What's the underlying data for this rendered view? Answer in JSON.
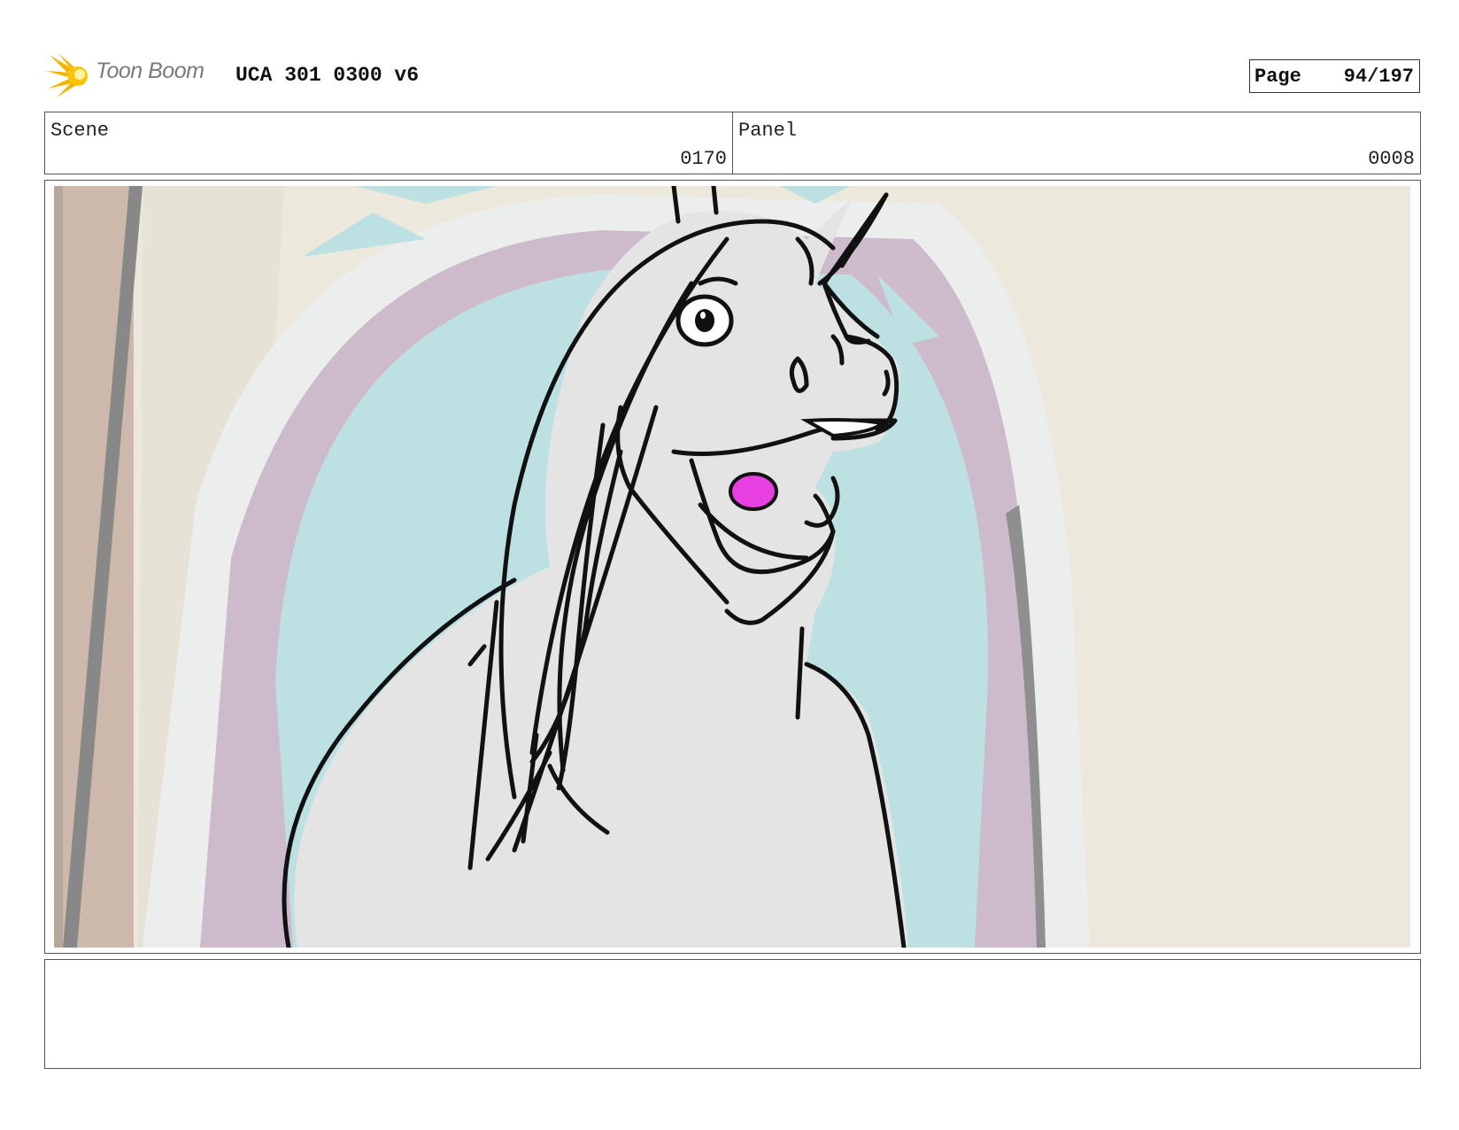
{
  "header": {
    "logo_text": "Toon Boom",
    "project_title": "UCA 301 0300 v6",
    "page_label": "Page",
    "page_value": "94/197"
  },
  "scene": {
    "label": "Scene",
    "value": "0170"
  },
  "panel": {
    "label": "Panel",
    "value": "0008"
  },
  "artwork": {
    "subject": "storyboard-sketch-unicorn",
    "colors": {
      "wall": "#ede8dc",
      "sky": "#bde0e3",
      "arch_trim": "#cfbccb",
      "frame": "#eef0ee",
      "body": "#e4e4e4",
      "tongue": "#e83fe0",
      "line": "#111111"
    }
  },
  "notes": {
    "text": ""
  }
}
